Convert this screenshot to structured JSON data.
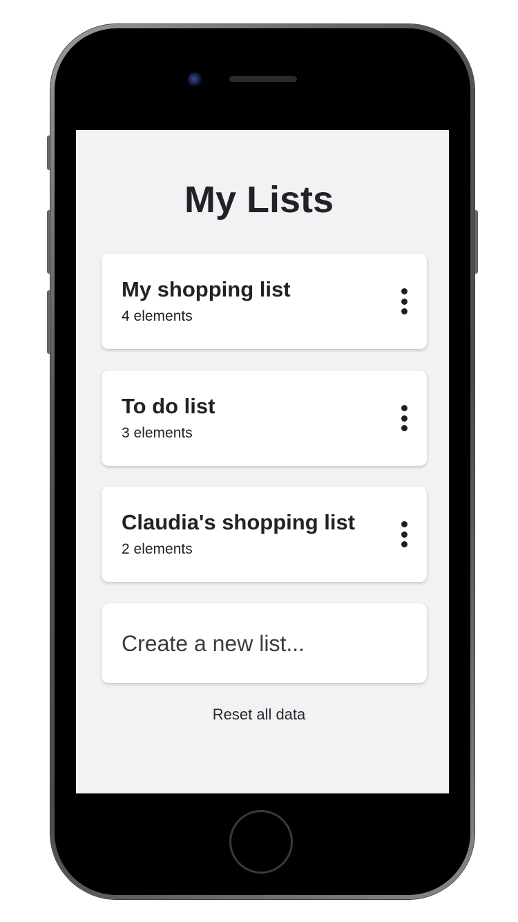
{
  "app": {
    "title": "My Lists"
  },
  "lists": [
    {
      "name": "My shopping list",
      "count_label": "4 elements"
    },
    {
      "name": "To do list",
      "count_label": "3 elements"
    },
    {
      "name": "Claudia's shopping list",
      "count_label": "2 elements"
    }
  ],
  "create": {
    "label": "Create a new list..."
  },
  "footer": {
    "reset_label": "Reset all data"
  },
  "icons": {
    "item_menu": "more-vertical-icon"
  },
  "colors": {
    "screen_background": "#f1f2f4",
    "card_background": "#ffffff",
    "text_primary": "#222226",
    "placeholder_text": "#3c3c40"
  }
}
